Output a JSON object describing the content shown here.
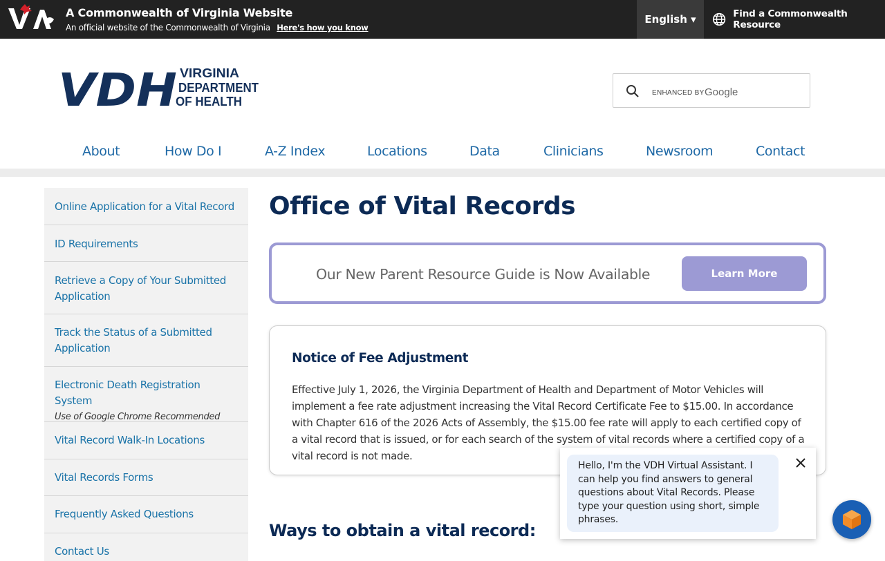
{
  "gov_banner": {
    "title": "A Commonwealth of Virginia Website",
    "subtitle": "An official website of the Commonwealth of Virginia",
    "how_link": "Here's how you know",
    "language": "English ▾",
    "find_resource": "Find a Commonwealth Resource"
  },
  "logo": {
    "line1": "VIRGINIA",
    "line2": "DEPARTMENT",
    "line3": "OF HEALTH",
    "mark": "VDH"
  },
  "search": {
    "enhanced_by": "ENHANCED BY",
    "provider": "Google"
  },
  "nav": [
    "About",
    "How Do I",
    "A-Z Index",
    "Locations",
    "Data",
    "Clinicians",
    "Newsroom",
    "Contact"
  ],
  "sidebar": {
    "items": [
      {
        "label": "Online Application for a Vital Record"
      },
      {
        "label": "ID Requirements"
      },
      {
        "label": "Retrieve a Copy of Your Submitted Application"
      },
      {
        "label": "Track the Status of a Submitted Application"
      },
      {
        "label": "Electronic Death Registration System",
        "note": "Use of Google Chrome Recommended"
      },
      {
        "label": "Vital Record Walk-In Locations"
      },
      {
        "label": "Vital Records Forms"
      },
      {
        "label": "Frequently Asked Questions"
      },
      {
        "label": "Contact Us"
      }
    ]
  },
  "main": {
    "title": "Office of Vital Records",
    "promo_text": "Our New Parent Resource Guide is Now Available",
    "promo_button": "Learn More",
    "notice_title": "Notice of Fee Adjustment",
    "notice_body": "Effective July 1, 2026, the Virginia Department of Health and Department of Motor Vehicles will implement a fee rate adjustment increasing the Vital Record Certificate Fee to $15.00. In accordance with Chapter 616 of the 2026 Acts of Assembly, the $15.00 fee rate will apply to each certified copy of a vital record that is issued, or for each search of the system of vital records where a certified copy of a vital record is not made.",
    "ways_heading": "Ways to obtain a vital record:"
  },
  "chat": {
    "message": "Hello, I'm the VDH Virtual Assistant. I can help you find answers to general questions about Vital Records. Please type your question using short, simple phrases."
  },
  "colors": {
    "banner_bg": "#222222",
    "navy": "#0c2a55",
    "link_blue": "#1a73a8",
    "promo_purple": "#9c9ad4",
    "chat_blue": "#1a5fb4"
  }
}
